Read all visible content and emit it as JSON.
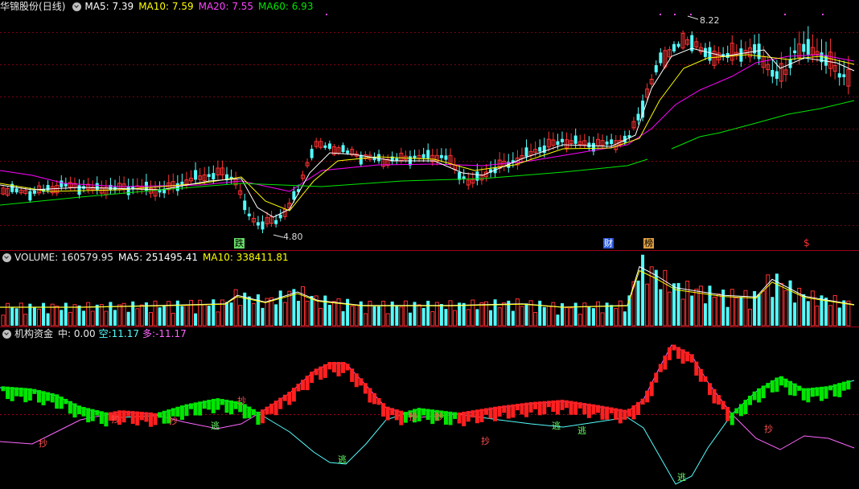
{
  "price": {
    "stock_name": "华锦股份",
    "period": "(日线)",
    "ma5_label": "MA5:",
    "ma5_value": "7.39",
    "ma10_label": "MA10:",
    "ma10_value": "7.59",
    "ma20_label": "MA20:",
    "ma20_value": "7.55",
    "ma60_label": "MA60:",
    "ma60_value": "6.93",
    "high_mark": "8.22",
    "low_mark": "4.80",
    "event_markers": [
      "跌",
      "财",
      "榜",
      "$"
    ]
  },
  "volume": {
    "label": "VOLUME:",
    "value": "160579.95",
    "ma5_label": "MA5:",
    "ma5_value": "251495.41",
    "ma10_label": "MA10:",
    "ma10_value": "338411.81"
  },
  "indicator": {
    "name": "机构资金",
    "mid_label": "中:",
    "mid_value": "0.00",
    "short_label": "空:",
    "short_value": "11.17",
    "long_label": "多:",
    "long_value": "-11.17",
    "signal_buy": "抄",
    "signal_sell": "逃"
  },
  "colors": {
    "up": "#ff3232",
    "down": "#54fcfc",
    "ma5": "#ffffff",
    "ma10": "#ffff00",
    "ma20": "#ff00ff",
    "ma60": "#00e600",
    "green_bar": "#00e600",
    "red_bar": "#ff2020"
  },
  "chart_data": {
    "type": "candlestick",
    "title": "",
    "price_range": [
      4.8,
      8.22
    ],
    "series": [
      {
        "name": "MA5",
        "latest": 7.39
      },
      {
        "name": "MA10",
        "latest": 7.59
      },
      {
        "name": "MA20",
        "latest": 7.55
      },
      {
        "name": "MA60",
        "latest": 6.93
      }
    ]
  }
}
